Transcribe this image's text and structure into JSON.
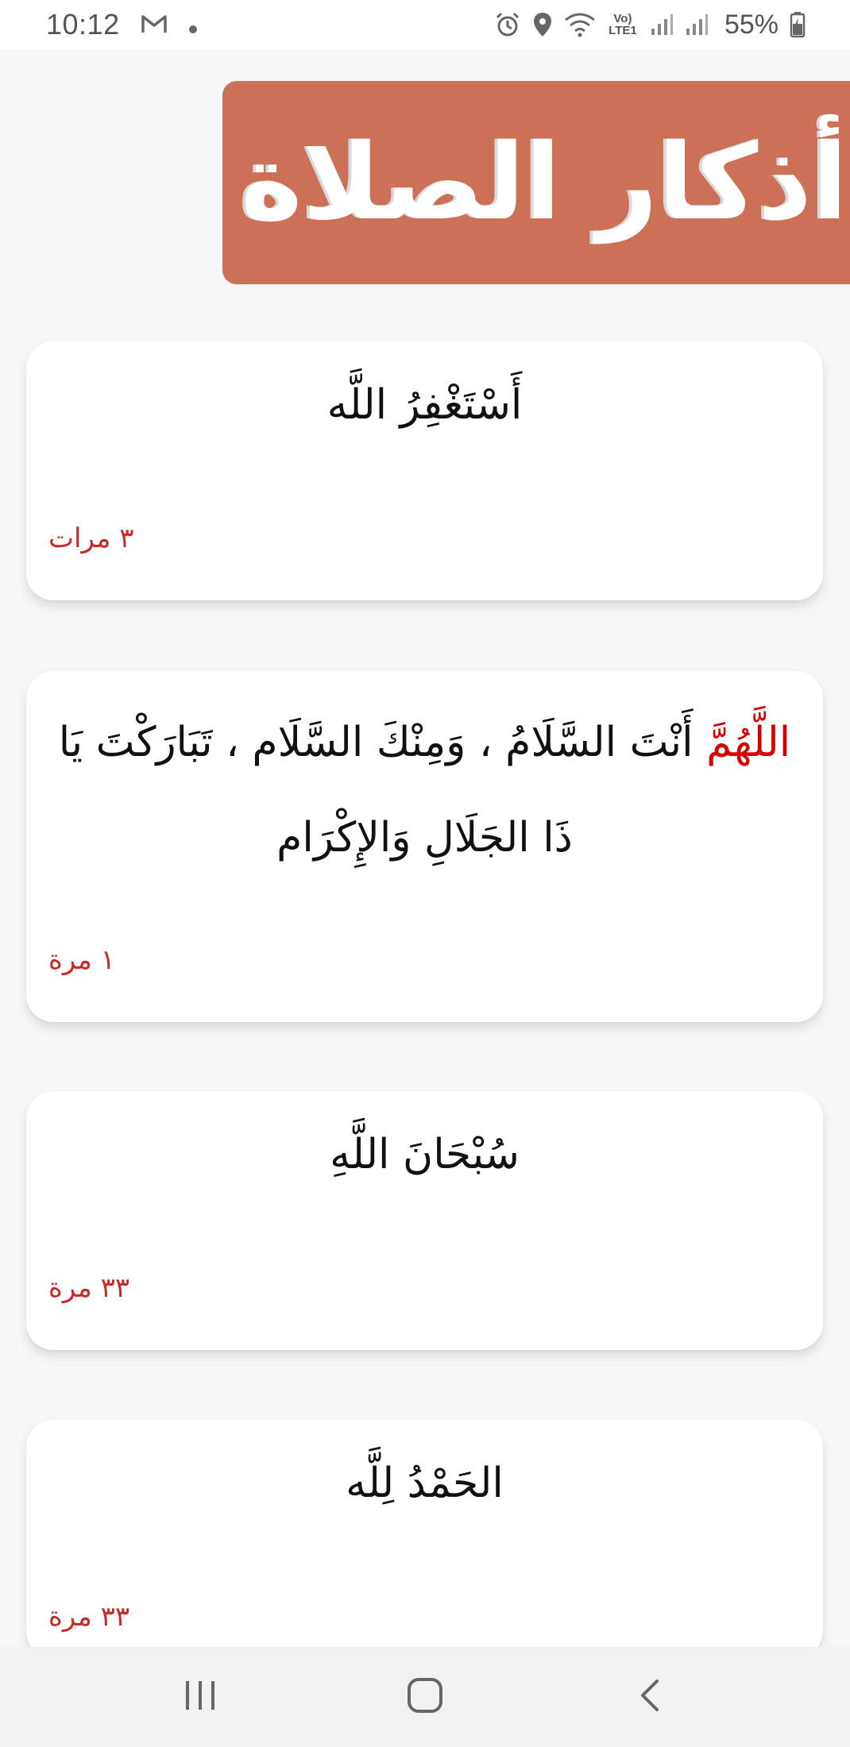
{
  "status_bar": {
    "time": "10:12",
    "notification_icons": [
      "gmail-icon",
      "dot-icon"
    ],
    "system_icons": [
      "alarm-icon",
      "location-icon",
      "wifi-icon",
      "volte-icon",
      "signal-icon",
      "signal-icon",
      "battery-icon"
    ],
    "volte_label": "Vo) LTE1",
    "battery": "55%"
  },
  "header": {
    "title": "أذكار الصلاة",
    "color": "#cc7157"
  },
  "cards": [
    {
      "text": "أَسْتَغْفِرُ اللَّه",
      "count": "٣ مرات"
    },
    {
      "highlight": "اللَّهُمَّ",
      "text": " أَنْتَ السَّلَامُ ، وَمِنْكَ السَّلَام ، تَبَارَكْتَ يَا ذَا الجَلَالِ وَالإِكْرَام",
      "count": "١ مرة"
    },
    {
      "text": "سُبْحَانَ اللَّهِ",
      "count": "٣٣ مرة"
    },
    {
      "text": "الحَمْدُ لِلَّه",
      "count": "٣٣ مرة"
    }
  ],
  "colors": {
    "count_text": "#c62828",
    "highlight_text": "#d40000",
    "background": "#f7f6f8"
  },
  "nav_bar": {
    "buttons": [
      "recent-apps-icon",
      "home-icon",
      "back-icon"
    ]
  }
}
